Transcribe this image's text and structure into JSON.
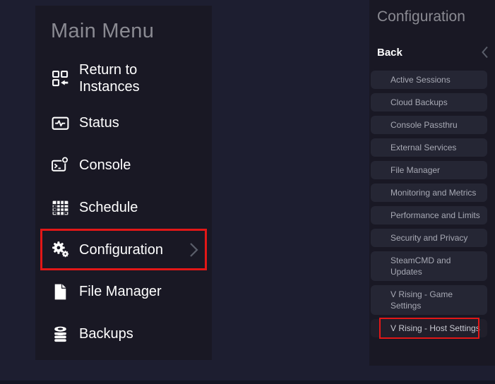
{
  "left_panel": {
    "title": "Main Menu",
    "items": [
      {
        "label": "Return to Instances",
        "icon": "instances-icon"
      },
      {
        "label": "Status",
        "icon": "status-icon"
      },
      {
        "label": "Console",
        "icon": "console-icon"
      },
      {
        "label": "Schedule",
        "icon": "schedule-icon"
      },
      {
        "label": "Configuration",
        "icon": "configuration-gears-icon",
        "highlighted": true,
        "has_submenu": true
      },
      {
        "label": "File Manager",
        "icon": "file-icon"
      },
      {
        "label": "Backups",
        "icon": "database-icon"
      }
    ]
  },
  "right_panel": {
    "title": "Configuration",
    "back_label": "Back",
    "buttons": [
      {
        "label": "Active Sessions"
      },
      {
        "label": "Cloud Backups"
      },
      {
        "label": "Console Passthru"
      },
      {
        "label": "External Services"
      },
      {
        "label": "File Manager"
      },
      {
        "label": "Monitoring and Metrics"
      },
      {
        "label": "Performance and Limits"
      },
      {
        "label": "Security and Privacy"
      },
      {
        "label": "SteamCMD and Updates"
      },
      {
        "label": "V Rising - Game Settings"
      },
      {
        "label": "V Rising - Host Settings",
        "highlighted": true
      }
    ]
  },
  "colors": {
    "background": "#1d1e30",
    "panel": "#191824",
    "button": "#252634",
    "highlight_red": "#e21717",
    "title_gray": "#8a8a92",
    "button_text": "#a7a9b4",
    "item_text": "#ffffff"
  }
}
